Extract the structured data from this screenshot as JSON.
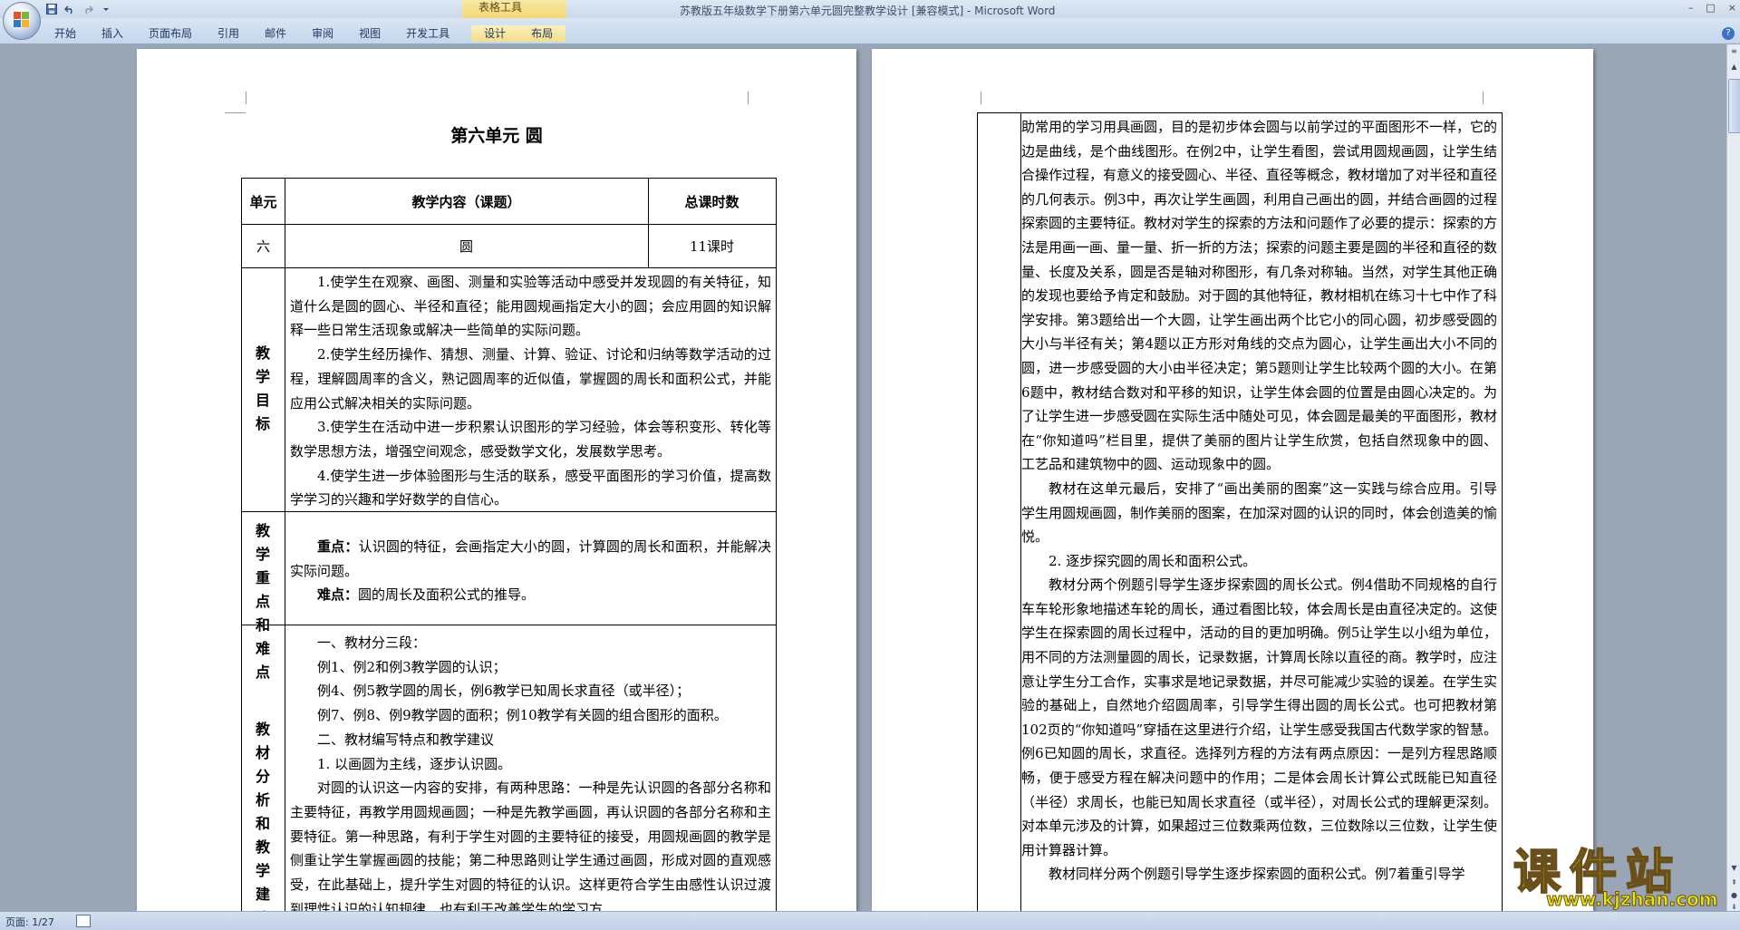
{
  "window": {
    "title": "苏教版五年级数学下册第六单元圆完整教学设计 [兼容模式] - Microsoft Word",
    "contextual_tab_group": "表格工具",
    "controls": [
      "–",
      "□",
      "×"
    ]
  },
  "quick_access": {
    "save_icon": "save-icon",
    "undo_icon": "undo-icon",
    "redo_icon": "redo-icon",
    "customize_icon": "dropdown-icon"
  },
  "ribbon": {
    "tabs": [
      "开始",
      "插入",
      "页面布局",
      "引用",
      "邮件",
      "审阅",
      "视图",
      "开发工具",
      "设计",
      "布局"
    ],
    "help": "?"
  },
  "left_page": {
    "title": "第六单元    圆",
    "table": {
      "headers": [
        "单元",
        "教学内容（课题）",
        "总课时数"
      ],
      "row1": [
        "六",
        "圆",
        "11课时"
      ],
      "goals_label": "教学目标",
      "goals": [
        "1.使学生在观察、画图、测量和实验等活动中感受并发现圆的有关特征，知道什么是圆的圆心、半径和直径；能用圆规画指定大小的圆；会应用圆的知识解释一些日常生活现象或解决一些简单的实际问题。",
        "2.使学生经历操作、猜想、测量、计算、验证、讨论和归纳等数学活动的过程，理解圆周率的含义，熟记圆周率的近似值，掌握圆的周长和面积公式，并能应用公式解决相关的实际问题。",
        "3.使学生在活动中进一步积累认识图形的学习经验，体会等积变形、转化等数学思想方法，增强空间观念，感受数学文化，发展数学思考。",
        "4.使学生进一步体验图形与生活的联系，感受平面图形的学习价值，提高数学学习的兴趣和学好数学的自信心。"
      ],
      "keypoints_label": "教学重点和难点",
      "keypoint_title": "重点：",
      "keypoint": "认识圆的特征，会画指定大小的圆，计算圆的周长和面积，并能解决实际问题。",
      "difficulty_title": "难点：",
      "difficulty": "圆的周长及面积公式的推导。",
      "analysis_label": "教材分析和教学建议",
      "analysis": [
        "一、教材分三段：",
        "例1、例2和例3教学圆的认识；",
        "例4、例5教学圆的周长，例6教学已知周长求直径（或半径）；",
        "例7、例8、例9教学圆的面积；例10教学有关圆的组合图形的面积。",
        "二、教材编写特点和教学建议",
        "1. 以画圆为主线，逐步认识圆。",
        "对圆的认识这一内容的安排，有两种思路：一种是先认识圆的各部分名称和主要特征，再教学用圆规画圆；一种是先教学画圆，再认识圆的各部分名称和主要特征。第一种思路，有利于学生对圆的主要特征的接受，用圆规画圆的教学是侧重让学生掌握画圆的技能；第二种思路则让学生通过画圆，形成对圆的直观感受，在此基础上，提升学生对圆的特征的认识。这样更符合学生由感性认识过渡到理性认识的认知规律，也有利于改善学生的学习方"
      ]
    }
  },
  "right_page": {
    "paragraphs": [
      "助常用的学习用具画圆，目的是初步体会圆与以前学过的平面图形不一样，它的边是曲线，是个曲线图形。在例2中，让学生看图，尝试用圆规画圆，让学生结合操作过程，有意义的接受圆心、半径、直径等概念，教材增加了对半径和直径的几何表示。例3中，再次让学生画圆，利用自己画出的圆，并结合画圆的过程探索圆的主要特征。教材对学生的探索的方法和问题作了必要的提示：探索的方法是用画一画、量一量、折一折的方法；探索的问题主要是圆的半径和直径的数量、长度及关系，圆是否是轴对称图形，有几条对称轴。当然，对学生其他正确的发现也要给予肯定和鼓励。对于圆的其他特征，教材相机在练习十七中作了科学安排。第3题给出一个大圆，让学生画出两个比它小的同心圆，初步感受圆的大小与半径有关；第4题以正方形对角线的交点为圆心，让学生画出大小不同的圆，进一步感受圆的大小由半径决定；第5题则让学生比较两个圆的大小。在第6题中，教材结合数对和平移的知识，让学生体会圆的位置是由圆心决定的。为了让学生进一步感受圆在实际生活中随处可见，体会圆是最美的平面图形，教材在“你知道吗”栏目里，提供了美丽的图片让学生欣赏，包括自然现象中的圆、工艺品和建筑物中的圆、运动现象中的圆。",
      "教材在这单元最后，安排了“画出美丽的图案”这一实践与综合应用。引导学生用圆规画圆，制作美丽的图案，在加深对圆的认识的同时，体会创造美的愉悦。",
      "2. 逐步探究圆的周长和面积公式。",
      "教材分两个例题引导学生逐步探索圆的周长公式。例4借助不同规格的自行车车轮形象地描述车轮的周长，通过看图比较，体会周长是由直径决定的。这使学生在探索圆的周长过程中，活动的目的更加明确。例5让学生以小组为单位，用不同的方法测量圆的周长，记录数据，计算周长除以直径的商。教学时，应注意让学生分工合作，实事求是地记录数据，并尽可能减少实验的误差。在学生实验的基础上，自然地介绍圆周率，引导学生得出圆的周长公式。也可把教材第102页的“你知道吗”穿插在这里进行介绍，让学生感受我国古代数学家的智慧。例6已知圆的周长，求直径。选择列方程的方法有两点原因：一是列方程思路顺畅，便于感受方程在解决问题中的作用；二是体会周长计算公式既能已知直径（半径）求周长，也能已知周长求直径（或半径），对周长公式的理解更深刻。对本单元涉及的计算，如果超过三位数乘两位数，三位数除以三位数，让学生使用计算器计算。",
      "教材同样分两个例题引导学生逐步探索圆的面积公式。例7着重引导学"
    ]
  },
  "status": {
    "page": "页面: 1/27"
  },
  "watermark": {
    "main": "课件站",
    "url": "www.kjzhan.com"
  }
}
